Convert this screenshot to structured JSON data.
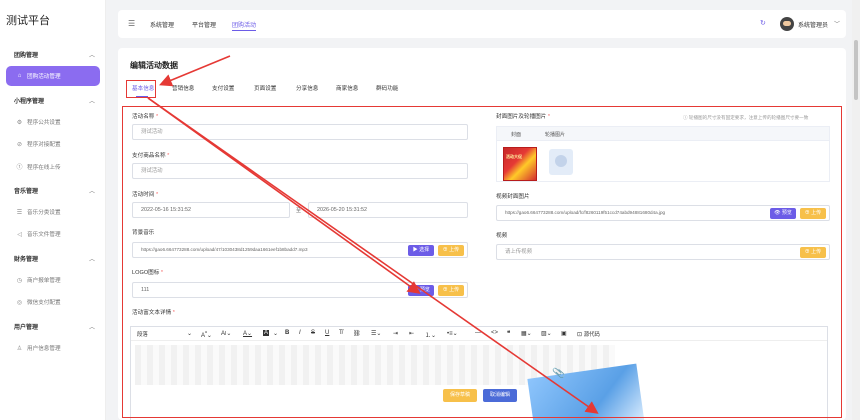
{
  "app_title": "测试平台",
  "sidebar": {
    "groups": [
      {
        "label": "团购管理",
        "items": [
          {
            "label": "团购活动管理",
            "active": true,
            "icon": "home-icon"
          }
        ]
      },
      {
        "label": "小程序管理",
        "items": [
          {
            "label": "程序公共设置",
            "icon": "gear-icon"
          },
          {
            "label": "程序对接配置",
            "icon": "link-icon"
          },
          {
            "label": "程序在线上传",
            "icon": "upload-icon"
          }
        ]
      },
      {
        "label": "音乐管理",
        "items": [
          {
            "label": "音乐分类设置",
            "icon": "list-icon"
          },
          {
            "label": "音乐文件管理",
            "icon": "music-icon"
          }
        ]
      },
      {
        "label": "财务管理",
        "items": [
          {
            "label": "商户报单管理",
            "icon": "clock-icon"
          },
          {
            "label": "微信支付配置",
            "icon": "shield-icon"
          }
        ]
      },
      {
        "label": "用户管理",
        "items": [
          {
            "label": "用户信息管理",
            "icon": "user-icon"
          }
        ]
      }
    ]
  },
  "topbar": {
    "nav": [
      "系统管理",
      "平台管理",
      "团购活动"
    ],
    "active_nav": 2,
    "admin_name": "系统管理员"
  },
  "panel": {
    "title": "编辑活动数据",
    "tabs": [
      "基本信息",
      "营销信息",
      "支付设置",
      "页面设置",
      "分享信息",
      "商家信息",
      "群码功能"
    ],
    "active_tab": 0,
    "hint": "ⓘ 轮播图的尺寸没有固定要求，注意上传的轮播图尺寸要一致",
    "left": {
      "activity_name_label": "活动名称",
      "activity_name_value": "测试活动",
      "product_name_label": "支付商品名称",
      "product_name_value": "测试活动",
      "time_label": "活动时间",
      "time_start": "2022-05-16 15:31:52",
      "time_sep": "至",
      "time_end": "2026-05-20 15:31:52",
      "bgm_label": "背景音乐",
      "bgm_value": "https://gao6.664773288.com/upload/47/1030438d1259daa1661eef1b8badd7.mp3",
      "select_btn": "▶ 选择",
      "upload_btn": "⊕ 上传",
      "logo_label": "LOGO图标",
      "logo_value": "111",
      "preview_btn": "👁 预览",
      "richtext_label": "活动富文本详情"
    },
    "right": {
      "cover_label": "封面图片及轮播图片",
      "col_cover": "封面",
      "col_carousel": "轮播图片",
      "cover_text": "活动大促",
      "video_cover_label": "视频封面图片",
      "video_cover_value": "https://gao6.664773288.com/upload/fc/f8260119f51ccd74abd94881680d4a.jpg",
      "video_label": "视频",
      "video_placeholder": "请上传视频"
    },
    "editor": {
      "paragraph": "段落",
      "save_draft": "保存草稿",
      "cancel_edit": "取消编辑",
      "source_code": "源代码"
    }
  },
  "colors": {
    "accent": "#6c5ce7",
    "annotation": "#e53935",
    "warning": "#f7c04a"
  }
}
